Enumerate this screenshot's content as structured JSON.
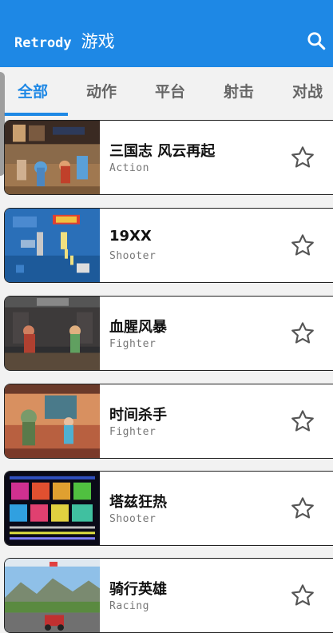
{
  "colors": {
    "primary": "#1E88E5",
    "tab_inactive": "#666666",
    "card_bg": "#ffffff"
  },
  "appbar": {
    "brand": "Retrody",
    "title": "游戏",
    "search_icon": "search-icon"
  },
  "tabs": [
    {
      "label": "全部",
      "active": true
    },
    {
      "label": "动作",
      "active": false
    },
    {
      "label": "平台",
      "active": false
    },
    {
      "label": "射击",
      "active": false
    },
    {
      "label": "对战",
      "active": false
    }
  ],
  "games": [
    {
      "title": "三国志 风云再起",
      "genre": "Action",
      "favorite_icon": "star-outline-icon"
    },
    {
      "title": "19XX",
      "genre": "Shooter",
      "favorite_icon": "star-outline-icon"
    },
    {
      "title": "血腥风暴",
      "genre": "Fighter",
      "favorite_icon": "star-outline-icon"
    },
    {
      "title": "时间杀手",
      "genre": "Fighter",
      "favorite_icon": "star-outline-icon"
    },
    {
      "title": "塔兹狂热",
      "genre": "Shooter",
      "favorite_icon": "star-outline-icon"
    },
    {
      "title": "骑行英雄",
      "genre": "Racing",
      "favorite_icon": "star-outline-icon"
    }
  ]
}
